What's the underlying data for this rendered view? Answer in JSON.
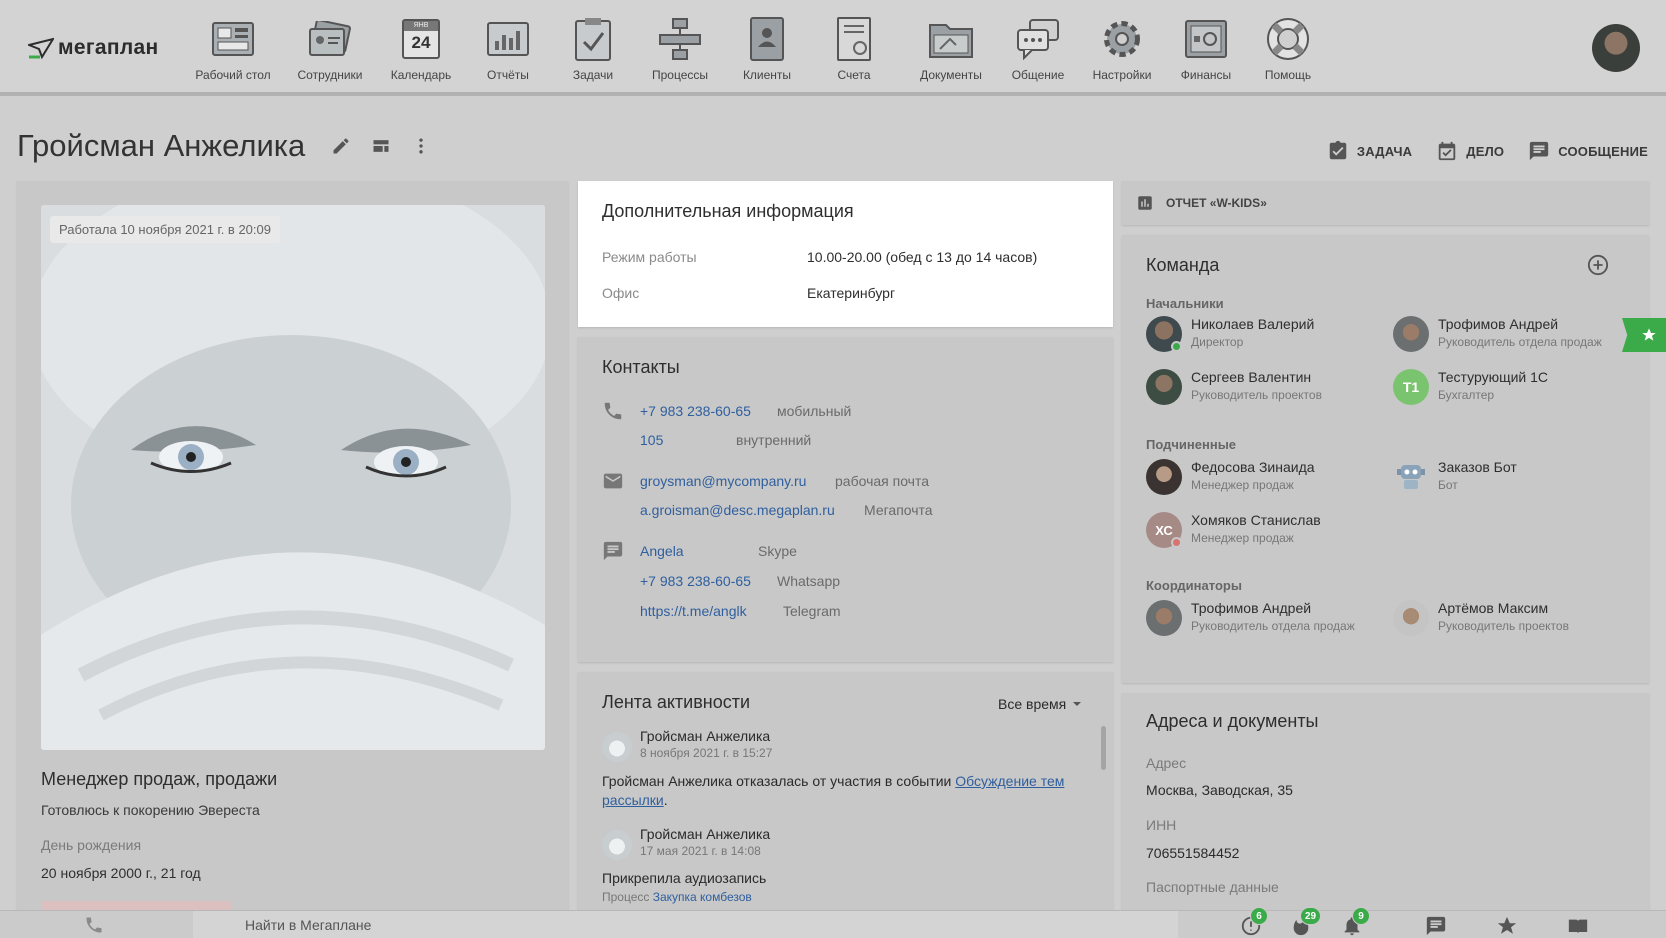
{
  "brand": {
    "logo_text": "мегаплан"
  },
  "nav": [
    {
      "label": "Рабочий стол",
      "icon": "desktop-icon"
    },
    {
      "label": "Сотрудники",
      "icon": "employees-icon"
    },
    {
      "label": "Календарь",
      "icon": "calendar-icon",
      "icon_text": "24",
      "icon_small": "ЯНВ"
    },
    {
      "label": "Отчёты",
      "icon": "reports-icon"
    },
    {
      "label": "Задачи",
      "icon": "tasks-icon"
    },
    {
      "label": "Процессы",
      "icon": "processes-icon"
    },
    {
      "label": "Клиенты",
      "icon": "clients-icon"
    },
    {
      "label": "Счета",
      "icon": "invoices-icon"
    },
    {
      "label": "Документы",
      "icon": "documents-icon"
    },
    {
      "label": "Общение",
      "icon": "chat-icon"
    },
    {
      "label": "Настройки",
      "icon": "settings-icon"
    },
    {
      "label": "Финансы",
      "icon": "finance-icon"
    },
    {
      "label": "Помощь",
      "icon": "help-icon"
    }
  ],
  "page": {
    "title": "Гройсман Анжелика"
  },
  "actions": {
    "task": "ЗАДАЧА",
    "deal": "ДЕЛО",
    "message": "СООБЩЕНИЕ"
  },
  "profile": {
    "last_seen": "Работала 10 ноября 2021 г. в 20:09",
    "role": "Менеджер продаж, продажи",
    "motto": "Готовлюсь к покорению Эвереста",
    "birthday_label": "День рождения",
    "birthday_value": "20 ноября 2000 г., 21 год"
  },
  "additional": {
    "title": "Дополнительная информация",
    "rows": [
      {
        "label": "Режим работы",
        "value": "10.00-20.00 (обед с 13 до 14 часов)"
      },
      {
        "label": "Офис",
        "value": "Екатеринбург"
      }
    ]
  },
  "contacts": {
    "title": "Контакты",
    "phones": [
      {
        "value": "+7 983 238-60-65",
        "type": "мобильный"
      },
      {
        "value": "105",
        "type": "внутренний"
      }
    ],
    "emails": [
      {
        "value": "groysman@mycompany.ru",
        "type": "рабочая почта"
      },
      {
        "value": "a.groisman@desc.megaplan.ru",
        "type": "Мегапочта"
      }
    ],
    "messengers": [
      {
        "value": "Angela",
        "type": "Skype"
      },
      {
        "value": "+7 983 238-60-65",
        "type": "Whatsapp"
      },
      {
        "value": "https://t.me/anglk",
        "type": "Telegram"
      }
    ]
  },
  "feed": {
    "title": "Лента активности",
    "filter": "Все время",
    "items": [
      {
        "author": "Гройсман Анжелика",
        "date": "8 ноября 2021 г. в 15:27",
        "text": "Гройсман Анжелика отказалась от участия в событии ",
        "link": "Обсуждение тем рассылки",
        "tail": "."
      },
      {
        "author": "Гройсман Анжелика",
        "date": "17 мая 2021 г. в 14:08",
        "text": "Прикрепила аудиозапись",
        "sub_label": "Процесс ",
        "sub_link": "Закупка комбезов"
      }
    ]
  },
  "report": {
    "label": "ОТЧЕТ «W-KIDS»"
  },
  "team": {
    "title": "Команда",
    "groups": [
      {
        "title": "Начальники",
        "members": [
          {
            "name": "Николаев Валерий",
            "role": "Директор"
          },
          {
            "name": "Трофимов Андрей",
            "role": "Руководитель отдела продаж"
          },
          {
            "name": "Сергеев Валентин",
            "role": "Руководитель проектов"
          },
          {
            "name": "Тестурующий 1С",
            "role": "Бухгалтер",
            "initials": "Т1"
          }
        ]
      },
      {
        "title": "Подчиненные",
        "members": [
          {
            "name": "Федосова Зинаида",
            "role": "Менеджер продаж"
          },
          {
            "name": "Заказов Бот",
            "role": "Бот"
          },
          {
            "name": "Хомяков Станислав",
            "role": "Менеджер продаж",
            "initials": "ХС"
          }
        ]
      },
      {
        "title": "Координаторы",
        "members": [
          {
            "name": "Трофимов Андрей",
            "role": "Руководитель отдела продаж"
          },
          {
            "name": "Артёмов Максим",
            "role": "Руководитель проектов"
          }
        ]
      }
    ]
  },
  "addresses": {
    "title": "Адреса и документы",
    "rows": [
      {
        "label": "Адрес",
        "value": "Москва, Заводская, 35"
      },
      {
        "label": "ИНН",
        "value": "706551584452"
      },
      {
        "label": "Паспортные данные",
        "value": ""
      }
    ]
  },
  "bottom": {
    "search_placeholder": "Найти в Мегаплане",
    "badges": {
      "alerts": "6",
      "hot": "29",
      "notifications": "9"
    }
  },
  "colors": {
    "accent": "#3bab4a",
    "link": "#2f5f9e",
    "overlay": "#cfcfcf"
  }
}
